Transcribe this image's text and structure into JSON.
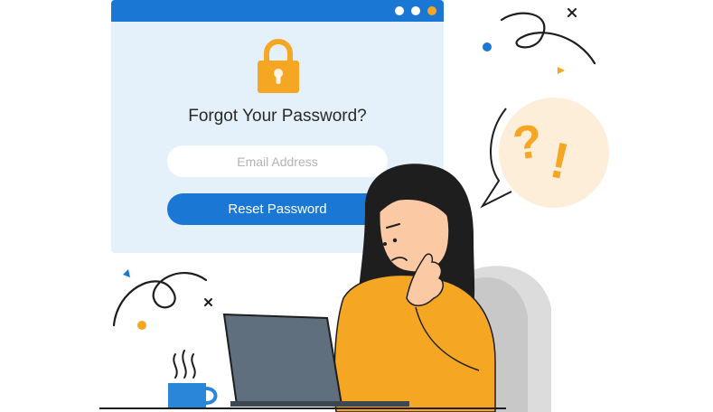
{
  "window": {
    "title_dots": [
      "#ffffff",
      "#ffffff",
      "#f5a623"
    ],
    "lock_icon": "lock-icon",
    "title": "Forgot Your Password?",
    "email_placeholder": "Email Address",
    "reset_button_label": "Reset Password"
  },
  "bubble": {
    "question_mark": "?",
    "exclamation_mark": "!"
  },
  "colors": {
    "accent_blue": "#1a78d4",
    "window_background": "#e4f0fa",
    "orange": "#f5a623",
    "bubble_fill": "#fdeeda",
    "laptop": "#5f6f7d"
  }
}
